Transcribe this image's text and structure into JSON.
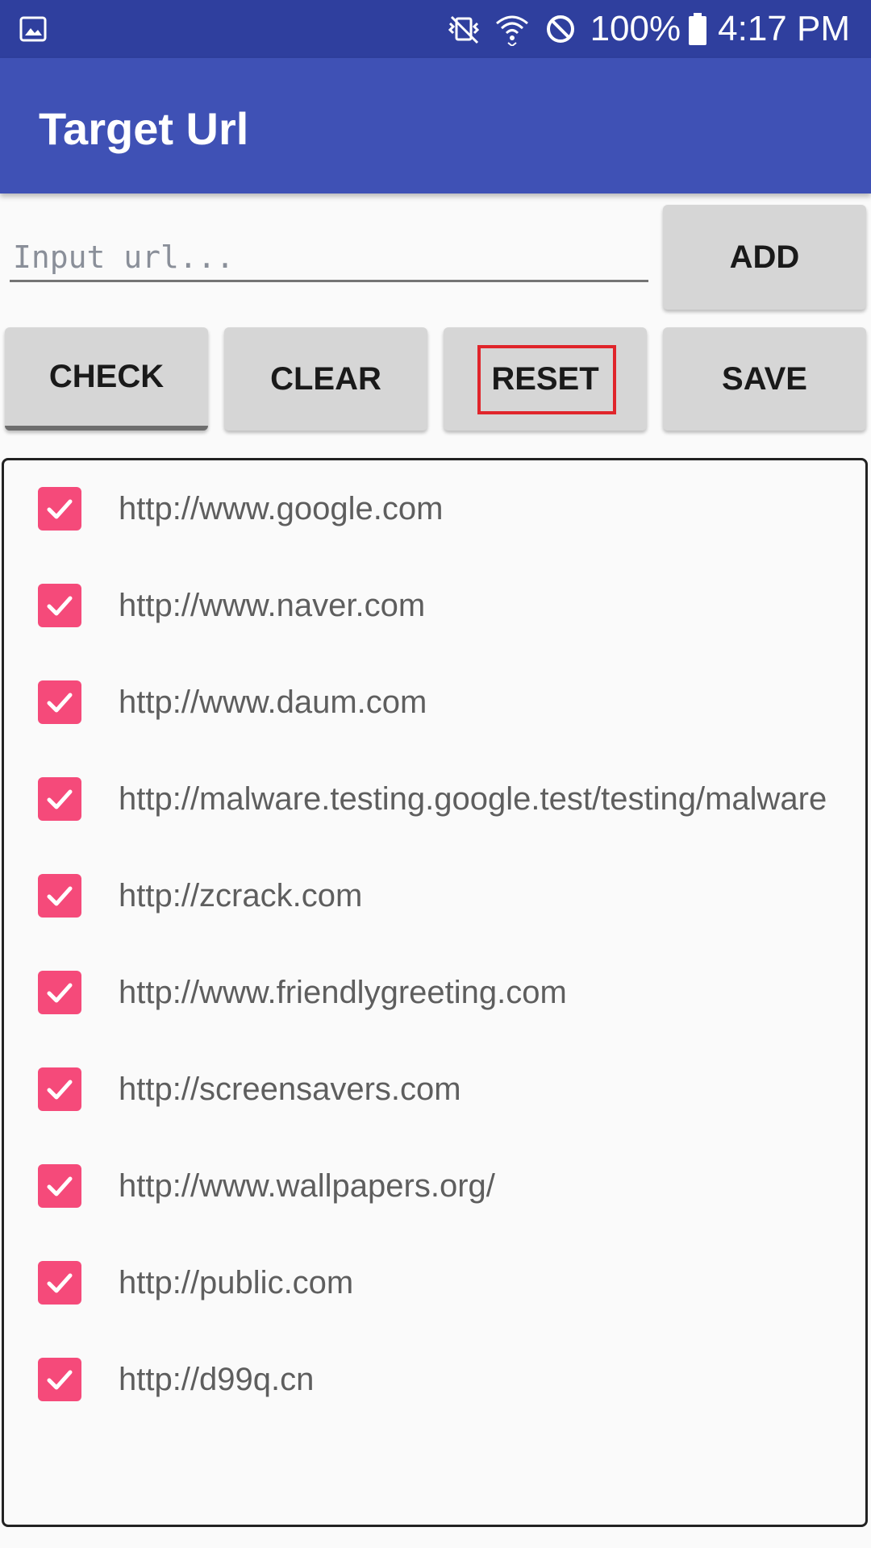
{
  "status_bar": {
    "icons": [
      "gallery-icon",
      "vibrate-mute-icon",
      "wifi-icon",
      "do-not-disturb-icon",
      "battery-icon"
    ],
    "battery_percent": "100%",
    "time": "4:17 PM"
  },
  "app_bar": {
    "title": "Target Url"
  },
  "input": {
    "placeholder": "Input url...",
    "value": ""
  },
  "buttons": {
    "add": "ADD",
    "check": "CHECK",
    "clear": "CLEAR",
    "reset": "RESET",
    "save": "SAVE"
  },
  "url_list": [
    {
      "url": "http://www.google.com",
      "checked": true
    },
    {
      "url": "http://www.naver.com",
      "checked": true
    },
    {
      "url": "http://www.daum.com",
      "checked": true
    },
    {
      "url": "http://malware.testing.google.test/testing/malware",
      "checked": true
    },
    {
      "url": "http://zcrack.com",
      "checked": true
    },
    {
      "url": "http://www.friendlygreeting.com",
      "checked": true
    },
    {
      "url": "http://screensavers.com",
      "checked": true
    },
    {
      "url": "http://www.wallpapers.org/",
      "checked": true
    },
    {
      "url": "http://public.com",
      "checked": true
    },
    {
      "url": "http://d99q.cn",
      "checked": true
    }
  ],
  "colors": {
    "status_bar": "#2F3F9E",
    "app_bar": "#3F51B5",
    "checkbox": "#F54A7A",
    "highlight": "#E0252B"
  }
}
